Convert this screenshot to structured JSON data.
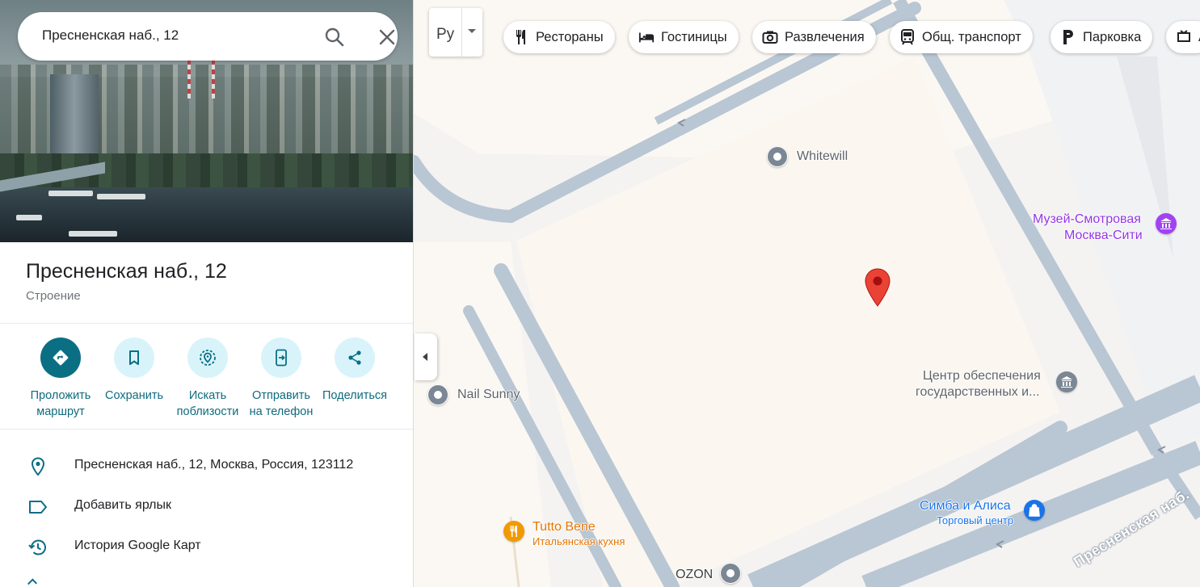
{
  "search": {
    "query": "Пресненская наб., 12"
  },
  "place": {
    "title": "Пресненская наб., 12",
    "category": "Строение"
  },
  "actions": [
    {
      "icon": "directions-icon",
      "label": "Проложить маршрут",
      "line1": "Проложить",
      "line2": "маршрут"
    },
    {
      "icon": "bookmark-icon",
      "label": "Сохранить",
      "line1": "Сохранить",
      "line2": ""
    },
    {
      "icon": "nearby-icon",
      "label": "Искать поблизости",
      "line1": "Искать",
      "line2": "поблизости"
    },
    {
      "icon": "send-to-phone-icon",
      "label": "Отправить на телефон",
      "line1": "Отправить",
      "line2": "на телефон"
    },
    {
      "icon": "share-icon",
      "label": "Поделиться",
      "line1": "Поделиться",
      "line2": ""
    }
  ],
  "info": [
    {
      "icon": "location-pin-icon",
      "text": "Пресненская наб., 12, Москва, Россия, 123112"
    },
    {
      "icon": "label-icon",
      "text": "Добавить ярлык"
    },
    {
      "icon": "history-icon",
      "text": "История Google Карт"
    }
  ],
  "map": {
    "layer_button_label": "Ру",
    "chips": [
      {
        "icon": "restaurant-icon",
        "label": "Рестораны"
      },
      {
        "icon": "hotel-icon",
        "label": "Гостиницы"
      },
      {
        "icon": "camera-icon",
        "label": "Развлечения"
      },
      {
        "icon": "transit-icon",
        "label": "Общ. транспорт"
      },
      {
        "icon": "parking-icon",
        "label": "Парковка"
      },
      {
        "icon": "more-icon",
        "label": "А"
      }
    ],
    "pois": {
      "whitewill": "Whitewill",
      "museum_line1": "Музей-Смотровая",
      "museum_line2": "Москва-Сити",
      "center_line1": "Центр обеспечения",
      "center_line2": "государственных и...",
      "nail": "Nail Sunny",
      "tutto": "Tutto Bene",
      "tutto_sub": "Итальянская кухня",
      "simba": "Симба и Алиса",
      "simba_sub": "Торговый центр",
      "ozon": "OZON"
    },
    "street": "Пресненская наб."
  },
  "colors": {
    "accent": "#0b6f84",
    "accent_light": "#d8f4fa",
    "marker": "#ea4335",
    "road": "#b9c6d3",
    "poi_purple": "#9334e6",
    "poi_orange": "#e37400",
    "poi_blue": "#1a73e8"
  }
}
